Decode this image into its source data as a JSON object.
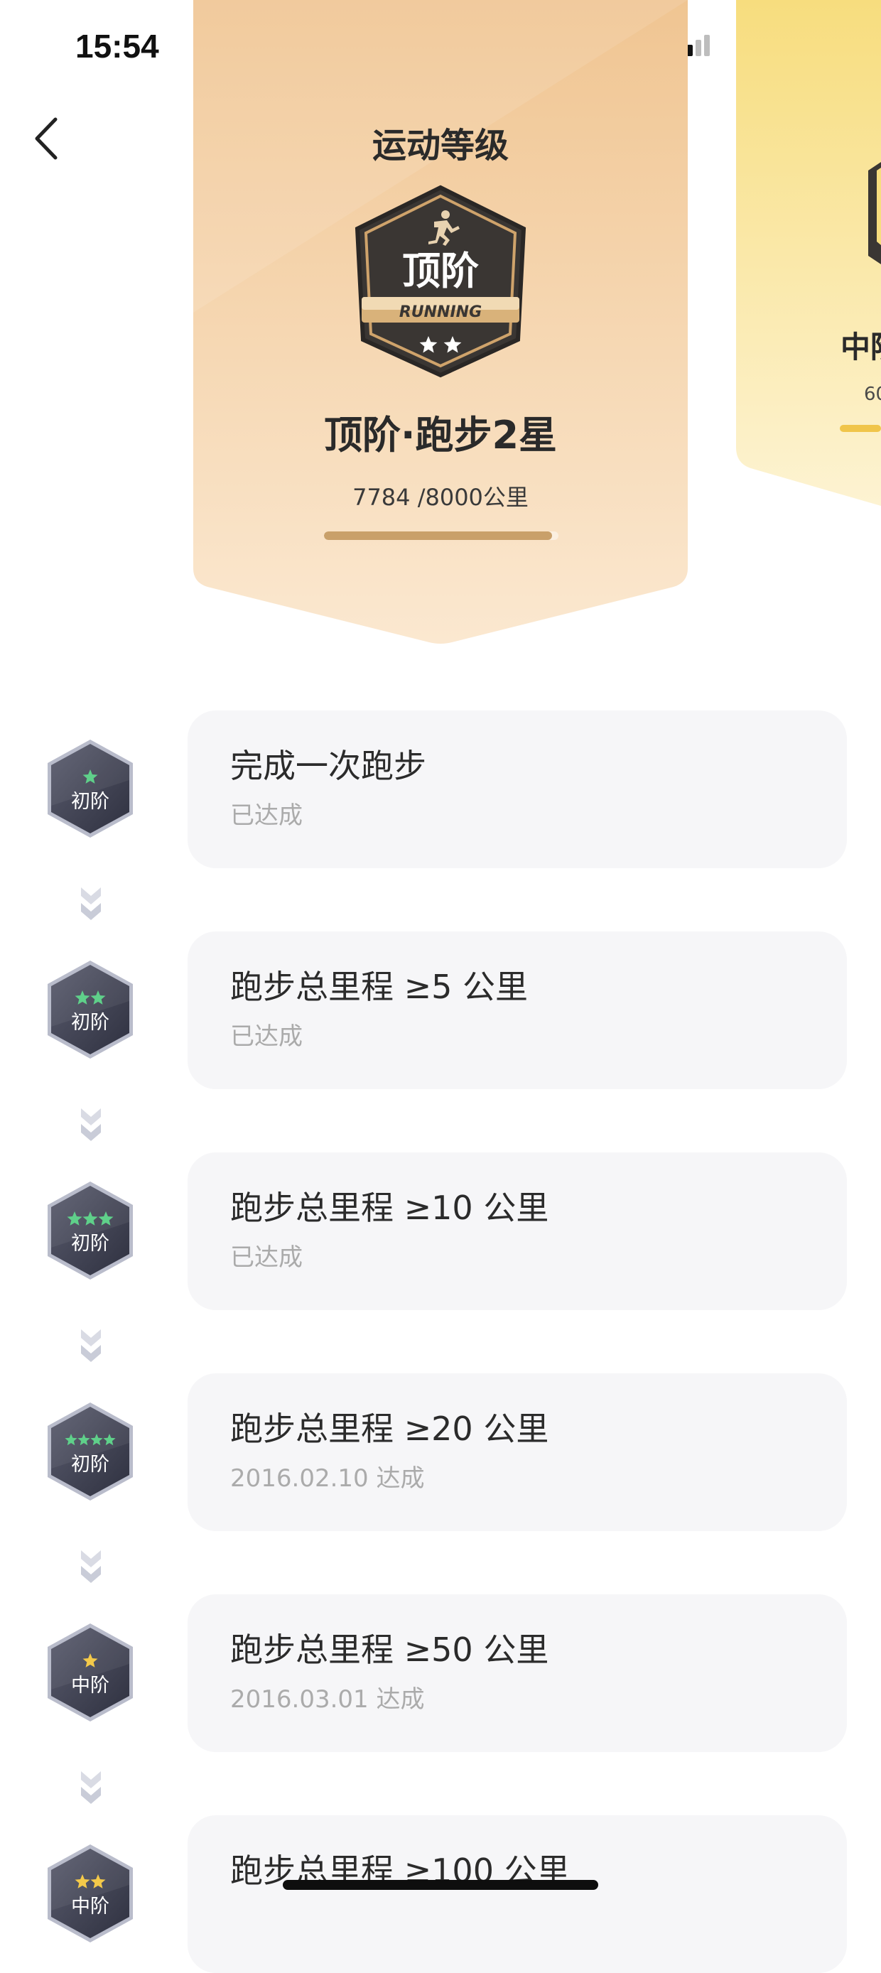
{
  "status_bar": {
    "time": "15:54"
  },
  "header": {
    "back_icon": "chevron-left-icon"
  },
  "level_card": {
    "title": "运动等级",
    "badge": {
      "text": "顶阶",
      "sport": "RUNNING",
      "stars": 2
    },
    "level_name": "顶阶·跑步2星",
    "progress_text": "7784 /8000公里",
    "progress": 0.973,
    "gradient_top": "#f0c592",
    "gradient_bottom": "#fbe8d0"
  },
  "next_card": {
    "name": "中阶",
    "sub": "60",
    "accent": "#f0c54a"
  },
  "milestones": [
    {
      "tier": "初阶",
      "stars": 1,
      "star_color": "#5fd08a",
      "title": "完成一次跑步",
      "status": "已达成"
    },
    {
      "tier": "初阶",
      "stars": 2,
      "star_color": "#5fd08a",
      "title": "跑步总里程 ≥5 公里",
      "status": "已达成"
    },
    {
      "tier": "初阶",
      "stars": 3,
      "star_color": "#5fd08a",
      "title": "跑步总里程 ≥10 公里",
      "status": "已达成"
    },
    {
      "tier": "初阶",
      "stars": 4,
      "star_color": "#5fd08a",
      "title": "跑步总里程 ≥20 公里",
      "status": "2016.02.10 达成"
    },
    {
      "tier": "中阶",
      "stars": 1,
      "star_color": "#f3c94a",
      "title": "跑步总里程 ≥50 公里",
      "status": "2016.03.01 达成"
    },
    {
      "tier": "中阶",
      "stars": 2,
      "star_color": "#f3c94a",
      "title": "跑步总里程 ≥100 公里",
      "status": ""
    }
  ]
}
